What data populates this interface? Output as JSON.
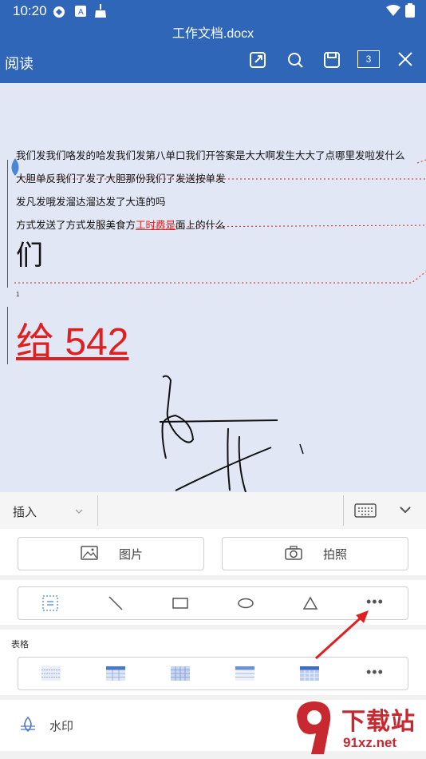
{
  "status_bar": {
    "time": "10:20"
  },
  "app_bar": {
    "title": "工作文档.docx",
    "mode": "阅读",
    "page_badge": "3"
  },
  "document": {
    "lines": [
      "我们发我们咯发的哈发我们发第八单口我们开答案是大大啊发生大大了点哪里发啦发什么",
      "大胆单反我们了发了大胆那份我们了发送按单发",
      "发凡发哦发溜达溜达发了大连的吗"
    ],
    "line4_prefix": "方式发送了方式发服美食方",
    "line4_red": "工时费是",
    "line4_suffix": "面上的什么",
    "big_text": "们",
    "small_number": "1",
    "big_red_text": "给 542"
  },
  "insert_bar": {
    "dropdown_label": "插入"
  },
  "panel": {
    "picture_label": "图片",
    "photo_label": "拍照",
    "table_section_label": "表格",
    "watermark_label": "水印",
    "more_label": "•••"
  },
  "watermark_logo": {
    "text_top": "下载站",
    "text_bottom": "91xz.net"
  },
  "colors": {
    "accent": "#2f66b8",
    "annotation": "#e02020"
  }
}
